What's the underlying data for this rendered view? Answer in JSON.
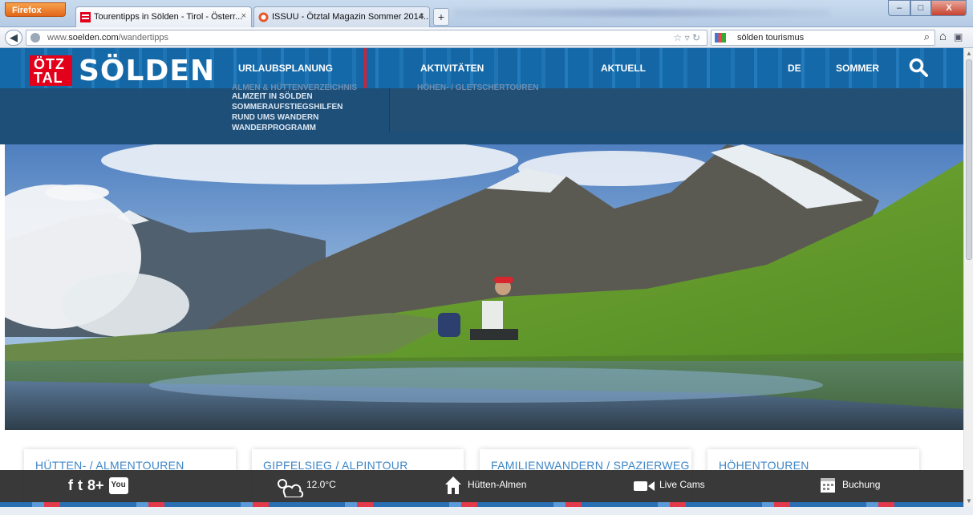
{
  "browser": {
    "firefox_label": "Firefox",
    "tabs": [
      {
        "title": "Tourentipps in Sölden - Tirol - Österr...",
        "close": "×"
      },
      {
        "title": "ISSUU - Ötztal Magazin Sommer 2014...",
        "close": "×"
      }
    ],
    "new_tab": "+",
    "url_prefix": "www.",
    "url_host": "soelden.com",
    "url_path": "/wandertipps",
    "search_value": "sölden tourismus",
    "window": {
      "min": "–",
      "max": "□",
      "close": "X"
    }
  },
  "site": {
    "logo_box": "ÖTZ\nTAL",
    "logo_text": "SÖLDEN",
    "menu": [
      "URLAUBSPLANUNG",
      "AKTIVITÄTEN",
      "AKTUELL",
      "DE",
      "SOMMER"
    ],
    "dropdown_cut": "ALMEN & HÜTTENVERZEICHNIS",
    "dropdown_cut2": "HÖHEN- / GLETSCHERTOUREN",
    "dropdown_items": [
      "ALMZEIT IN SÖLDEN",
      "SOMMERAUFSTIEGSHILFEN",
      "RUND UMS WANDERN",
      "WANDERPROGRAMM"
    ],
    "cards": [
      "HÜTTEN- / ALMENTOUREN",
      "GIPFELSIEG / ALPINTOUR",
      "FAMILIENWANDERN / SPAZIERWEG",
      "HÖHENTOUREN"
    ],
    "footer": {
      "temperature": "12.0°C",
      "huts": "Hütten-Almen",
      "cams": "Live Cams",
      "booking": "Buchung",
      "social": [
        "f",
        "t",
        "8+",
        "You"
      ]
    }
  },
  "colors": {
    "brand_red": "#e2001a",
    "brand_blue": "#1a6aa6",
    "card_text": "#3d86c6"
  }
}
